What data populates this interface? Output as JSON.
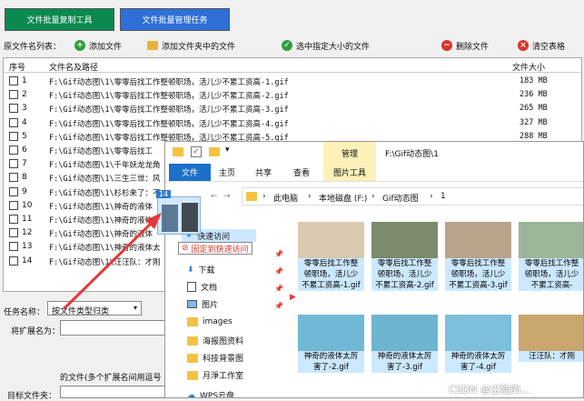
{
  "top_buttons": {
    "copy": "文件批量复制工具",
    "manage": "文件批量管理任务"
  },
  "toolbar": {
    "list_label": "原文件名列表：",
    "add_file": "添加文件",
    "add_folder_files": "添加文件夹中的文件",
    "select_by_size": "选中指定大小的文件",
    "delete_file": "删除文件",
    "clear_table": "清空表格"
  },
  "table": {
    "headers": {
      "num": "序号",
      "path": "文件名及路径",
      "size": "文件大小"
    },
    "rows": [
      {
        "num": "1",
        "path": "F:\\Gif动态图\\1\\零零后找工作整顿职场，活儿少不累工资高-1.gif",
        "size": "183 MB"
      },
      {
        "num": "2",
        "path": "F:\\Gif动态图\\1\\零零后找工作整顿职场，活儿少不累工资高-2.gif",
        "size": "236 MB"
      },
      {
        "num": "3",
        "path": "F:\\Gif动态图\\1\\零零后找工作整顿职场，活儿少不累工资高-3.gif",
        "size": "265 MB"
      },
      {
        "num": "4",
        "path": "F:\\Gif动态图\\1\\零零后找工作整顿职场，活儿少不累工资高-4.gif",
        "size": "327 MB"
      },
      {
        "num": "5",
        "path": "F:\\Gif动态图\\1\\零零后找工作整顿职场，活儿少不累工资高-5.gif",
        "size": "288 MB"
      },
      {
        "num": "6",
        "path": "F:\\Gif动态图\\1\\零零后找工",
        "size": ""
      },
      {
        "num": "7",
        "path": "F:\\Gif动态图\\1\\千年妖龙龙角",
        "size": ""
      },
      {
        "num": "8",
        "path": "F:\\Gif动态图\\1\\三生三世：风",
        "size": ""
      },
      {
        "num": "9",
        "path": "F:\\Gif动态图\\1\\杉杉来了：不",
        "size": ""
      },
      {
        "num": "10",
        "path": "F:\\Gif动态图\\1\\神奇的液体",
        "size": ""
      },
      {
        "num": "11",
        "path": "F:\\Gif动态图\\1\\神奇的液体",
        "size": ""
      },
      {
        "num": "12",
        "path": "F:\\Gif动态图\\1\\神奇的液体",
        "size": ""
      },
      {
        "num": "13",
        "path": "F:\\Gif动态图\\1\\神奇的液体太",
        "size": ""
      },
      {
        "num": "14",
        "path": "F:\\Gif动态图\\1\\汪汪队：才刚",
        "size": ""
      }
    ]
  },
  "form": {
    "task_label": "任务名称：",
    "task_value": "按文件类型归类",
    "ext_label": "将扩展名为：",
    "ext_hint": "的文件(多个扩展名间用逗号",
    "target_label": "目标文件夹："
  },
  "drag": {
    "count_badge": "14"
  },
  "explorer": {
    "ribbon_file": "文件",
    "ribbon_home": "主页",
    "ribbon_share": "共享",
    "ribbon_view": "查看",
    "ribbon_manage": "管理",
    "ribbon_picture_tools": "图片工具",
    "title_path": "F:\\Gif动态图\\1",
    "crumbs": [
      "此电脑",
      "本地磁盘 (F:)",
      "Gif动态图",
      "1"
    ],
    "nav": {
      "quick": "快速访问",
      "pin_tip": "固定到快速访问",
      "downloads": "下载",
      "documents": "文档",
      "pictures": "图片",
      "images": "images",
      "poster": "海报图资料",
      "tech_bg": "科技背景图",
      "yuejing": "月淨工作室",
      "wps": "WPS云盘"
    },
    "thumbs": [
      {
        "cap1": "零零后找工作整",
        "cap2": "顿职场，活儿少",
        "cap3": "不累工资高-1.gif"
      },
      {
        "cap1": "零零后找工作整",
        "cap2": "顿职场，活儿少",
        "cap3": "不累工资高-2.gif"
      },
      {
        "cap1": "零零后找工作整",
        "cap2": "顿职场，活儿少",
        "cap3": "不累工资高-3.gif"
      },
      {
        "cap1": "零零后找工作整",
        "cap2": "顿职场，活儿少",
        "cap3": "不累工资高-"
      },
      {
        "cap1": "神奇的液体太厉",
        "cap2": "害了-2.gif",
        "cap3": ""
      },
      {
        "cap1": "神奇的液体太厉",
        "cap2": "害了-3.gif",
        "cap3": ""
      },
      {
        "cap1": "神奇的液体太厉",
        "cap2": "害了-4.gif",
        "cap3": ""
      },
      {
        "cap1": "汪汪队：才刚",
        "cap2": "",
        "cap3": ""
      }
    ]
  },
  "watermark": "CSDN @尘隐的..."
}
